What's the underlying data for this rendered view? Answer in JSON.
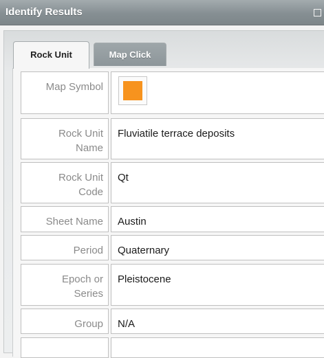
{
  "window": {
    "title": "Identify Results"
  },
  "tabs": [
    {
      "label": "Rock Unit",
      "active": true
    },
    {
      "label": "Map Click",
      "active": false
    }
  ],
  "colors": {
    "map_symbol_swatch": "#f7931e",
    "title_bar": "#868f93"
  },
  "attributes": [
    {
      "label": "Map Symbol",
      "value": ""
    },
    {
      "label": "Rock Unit Name",
      "value": "Fluviatile terrace deposits"
    },
    {
      "label": "Rock Unit Code",
      "value": "Qt"
    },
    {
      "label": "Sheet Name",
      "value": "Austin"
    },
    {
      "label": "Period",
      "value": "Quaternary"
    },
    {
      "label": "Epoch or Series",
      "value": "Pleistocene"
    },
    {
      "label": "Group",
      "value": "N/A"
    }
  ]
}
